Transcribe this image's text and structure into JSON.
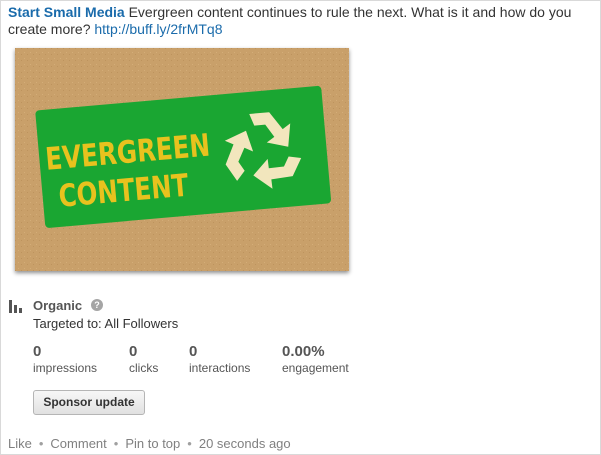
{
  "post": {
    "author": "Start Small Media",
    "text": " Evergreen content continues to rule the next. What is it and how do you create more? ",
    "link": "http://buff.ly/2frMTq8"
  },
  "image": {
    "line1": "EVERGREEN",
    "line2": "CONTENT",
    "colors": {
      "cardboard": "#c9a06a",
      "sign_green": "#1aa632",
      "sign_text": "#e8c21e",
      "recycle_symbol": "#f2e6bd"
    }
  },
  "stats_header": {
    "title": "Organic",
    "help_icon": "?",
    "targeted": "Targeted to: All Followers"
  },
  "stats": [
    {
      "value": "0",
      "label": "impressions"
    },
    {
      "value": "0",
      "label": "clicks"
    },
    {
      "value": "0",
      "label": "interactions"
    },
    {
      "value": "0.00%",
      "label": "engagement"
    }
  ],
  "sponsor_button": "Sponsor update",
  "footer": {
    "like": "Like",
    "comment": "Comment",
    "pin": "Pin to top",
    "time": "20 seconds ago",
    "separator": "•"
  },
  "colors": {
    "link": "#1a6bab",
    "muted": "#808080"
  }
}
